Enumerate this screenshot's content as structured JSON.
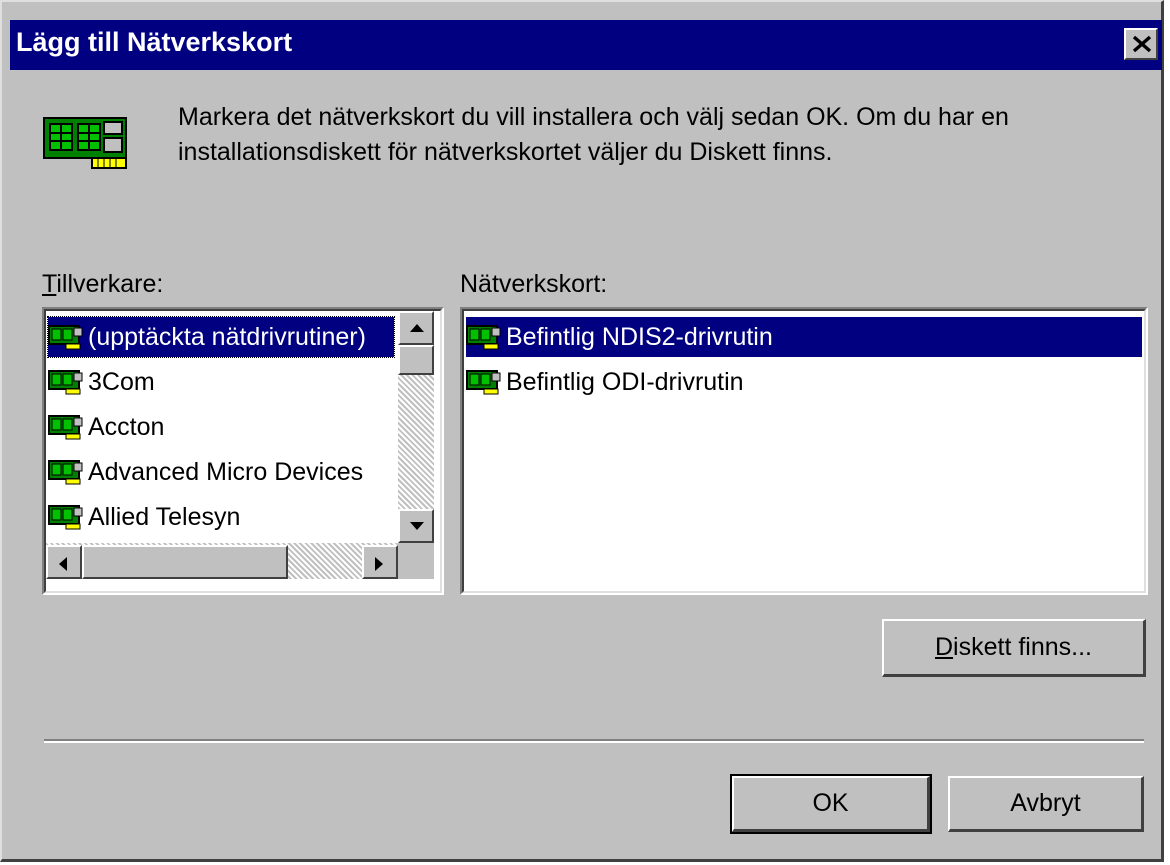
{
  "window": {
    "title": "Lägg till Nätverkskort"
  },
  "icons": {
    "big": "network-card-icon",
    "row": "network-card-icon",
    "close": "close-icon"
  },
  "instructions": "Markera det nätverkskort du vill installera och välj sedan OK. Om du har en installationsdiskett för nätverkskortet väljer du Diskett finns.",
  "manufacturers": {
    "label_mnemonic": "T",
    "label_rest": "illverkare:",
    "items": [
      {
        "label": "(upptäckta nätdrivrutiner)",
        "selected": true
      },
      {
        "label": "3Com",
        "selected": false
      },
      {
        "label": "Accton",
        "selected": false
      },
      {
        "label": "Advanced Micro Devices",
        "selected": false
      },
      {
        "label": "Allied Telesyn",
        "selected": false
      }
    ]
  },
  "adapters": {
    "label": "Nätverkskort:",
    "items": [
      {
        "label": "Befintlig NDIS2-drivrutin",
        "selected": true
      },
      {
        "label": "Befintlig ODI-drivrutin",
        "selected": false
      }
    ]
  },
  "buttons": {
    "disk_mnemonic": "D",
    "disk_rest": "iskett finns...",
    "ok": "OK",
    "cancel": "Avbryt"
  },
  "colors": {
    "face": "#c0c0c0",
    "titlebar": "#000080",
    "highlight": "#000080"
  }
}
